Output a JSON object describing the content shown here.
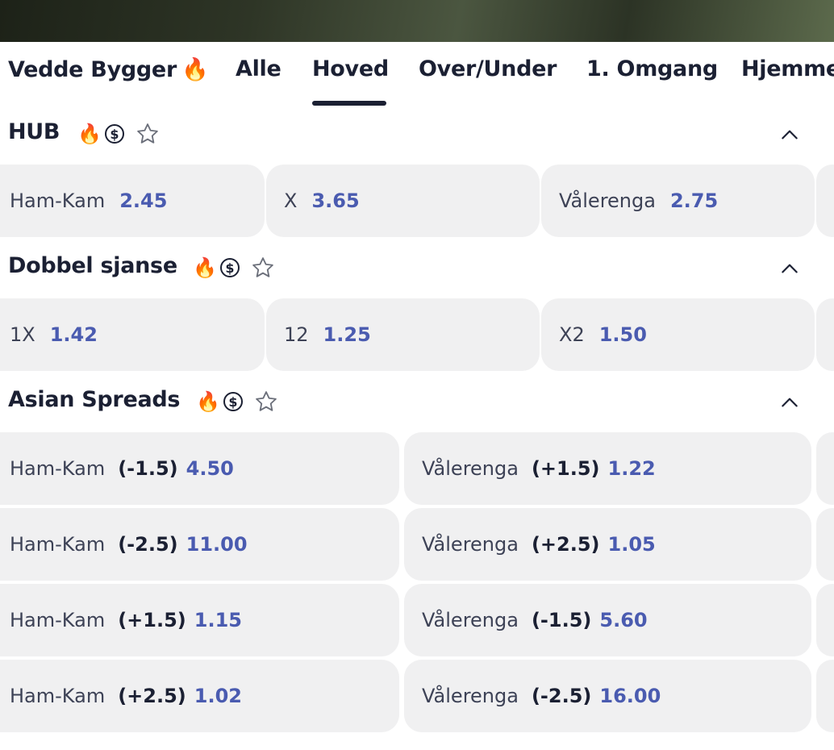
{
  "tabs": [
    {
      "label": "Vedde Bygger",
      "icon": "fire"
    },
    {
      "label": "Alle"
    },
    {
      "label": "Hoved",
      "active": true
    },
    {
      "label": "Over/Under"
    },
    {
      "label": "1. Omgang"
    },
    {
      "label": "Hjemme"
    }
  ],
  "colors": {
    "accent": "#4a5bb0",
    "text": "#1b2033",
    "cell_bg": "#f0f0f1"
  },
  "sections": [
    {
      "title": "HUB",
      "icons": [
        "fire-icon",
        "dollar-icon",
        "star-icon"
      ],
      "outcomes": [
        {
          "label": "Ham-Kam",
          "odds": "2.45"
        },
        {
          "label": "X",
          "odds": "3.65"
        },
        {
          "label": "Vålerenga",
          "odds": "2.75"
        }
      ]
    },
    {
      "title": "Dobbel sjanse",
      "icons": [
        "fire-icon",
        "dollar-icon",
        "star-icon"
      ],
      "outcomes": [
        {
          "label": "1X",
          "odds": "1.42"
        },
        {
          "label": "12",
          "odds": "1.25"
        },
        {
          "label": "X2",
          "odds": "1.50"
        }
      ]
    },
    {
      "title": "Asian Spreads",
      "icons": [
        "fire-icon",
        "dollar-icon",
        "star-icon"
      ],
      "rows": [
        [
          {
            "label": "Ham-Kam",
            "handicap": "(-1.5)",
            "odds": "4.50"
          },
          {
            "label": "Vålerenga",
            "handicap": "(+1.5)",
            "odds": "1.22"
          }
        ],
        [
          {
            "label": "Ham-Kam",
            "handicap": "(-2.5)",
            "odds": "11.00"
          },
          {
            "label": "Vålerenga",
            "handicap": "(+2.5)",
            "odds": "1.05"
          }
        ],
        [
          {
            "label": "Ham-Kam",
            "handicap": "(+1.5)",
            "odds": "1.15"
          },
          {
            "label": "Vålerenga",
            "handicap": "(-1.5)",
            "odds": "5.60"
          }
        ],
        [
          {
            "label": "Ham-Kam",
            "handicap": "(+2.5)",
            "odds": "1.02"
          },
          {
            "label": "Vålerenga",
            "handicap": "(-2.5)",
            "odds": "16.00"
          }
        ]
      ]
    }
  ]
}
